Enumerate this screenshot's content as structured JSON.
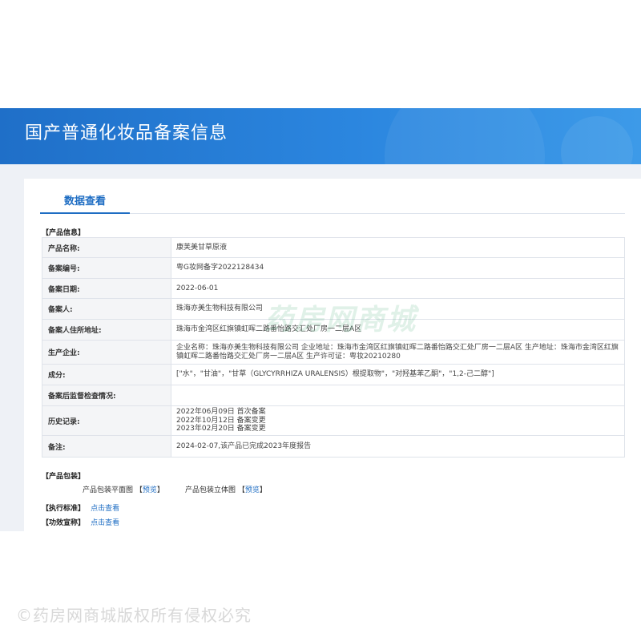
{
  "page": {
    "title": "国产普通化妆品备案信息"
  },
  "tab": {
    "label": "数据查看"
  },
  "sections": {
    "product_info": "【产品信息】",
    "product_package": "【产品包装】",
    "standard": "【执行标准】",
    "claim": "【功效宣称】"
  },
  "rows": [
    {
      "label": "产品名称:",
      "value": "康芙美甘草原液"
    },
    {
      "label": "备案编号:",
      "value": "粤G妆网备字2022128434"
    },
    {
      "label": "备案日期:",
      "value": "2022-06-01"
    },
    {
      "label": "备案人:",
      "value": "珠海亦美生物科技有限公司"
    },
    {
      "label": "备案人住所地址:",
      "value": "珠海市金湾区红旗镇虹晖二路番怡路交汇处厂房一二层A区"
    },
    {
      "label": "生产企业:",
      "value": "企业名称：珠海亦美生物科技有限公司 企业地址：珠海市金湾区红旗镇虹晖二路番怡路交汇处厂房一二层A区 生产地址：珠海市金湾区红旗镇虹晖二路番怡路交汇处厂房一二层A区 生产许可证：粤妆20210280"
    },
    {
      "label": "成分:",
      "value": "[\"水\"，\"甘油\"，\"甘草（GLYCYRRHIZA URALENSIS）根提取物\"，\"对羟基苯乙酮\"，\"1,2-己二醇\"]"
    },
    {
      "label": "备案后监督检查情况:",
      "value": ""
    },
    {
      "label": "历史记录:",
      "value": "",
      "history": [
        "2022年06月09日 首次备案",
        "2022年10月12日 备案变更",
        "2023年02月20日 备案变更"
      ]
    },
    {
      "label": "备注:",
      "value": "2024-02-07,该产品已完成2023年度报告"
    }
  ],
  "package": {
    "plan_label": "产品包装平面图",
    "plan_link": "预览",
    "stereo_label": "产品包装立体图",
    "stereo_link": "预览"
  },
  "links": {
    "standard_link": "点击查看",
    "claim_link": "点击查看"
  },
  "watermarks": {
    "center": "药房网商城",
    "bottom": "©药房网商城版权所有侵权必究"
  },
  "colors": {
    "banner": "#2b86df",
    "accent": "#1e6dc3",
    "label_bg": "#f4f5f7"
  }
}
